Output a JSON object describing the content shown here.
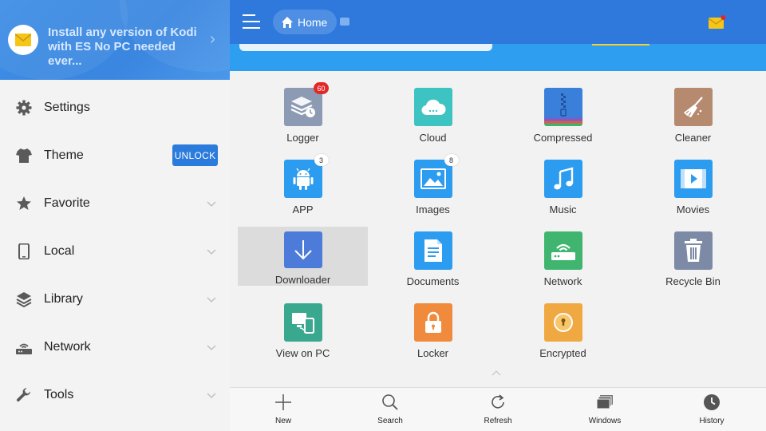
{
  "promo": {
    "text": "Install any version of Kodi with ES No PC needed ever..."
  },
  "sidebar": {
    "items": [
      {
        "label": "Settings",
        "icon": "gear-icon"
      },
      {
        "label": "Theme",
        "icon": "shirt-icon",
        "action": "UNLOCK"
      },
      {
        "label": "Favorite",
        "icon": "star-icon"
      },
      {
        "label": "Local",
        "icon": "phone-icon"
      },
      {
        "label": "Library",
        "icon": "layers-icon"
      },
      {
        "label": "Network",
        "icon": "router-icon"
      },
      {
        "label": "Tools",
        "icon": "wrench-icon"
      }
    ]
  },
  "header": {
    "breadcrumb": "Home"
  },
  "grid": [
    {
      "label": "Logger",
      "badge": "60",
      "color": "#8c9bb3"
    },
    {
      "label": "Cloud",
      "badge": "",
      "color": "#3ec3c3"
    },
    {
      "label": "Compressed",
      "badge": "",
      "color": "#3a7fd9"
    },
    {
      "label": "Cleaner",
      "badge": "",
      "color": "#b58a6e"
    },
    {
      "label": "APP",
      "badge": "3",
      "color": "#2b9cf0"
    },
    {
      "label": "Images",
      "badge": "8",
      "color": "#2b9cf0"
    },
    {
      "label": "Music",
      "badge": "",
      "color": "#2b9cf0"
    },
    {
      "label": "Movies",
      "badge": "",
      "color": "#2b9cf0"
    },
    {
      "label": "Downloader",
      "badge": "",
      "color": "#4d7bd9"
    },
    {
      "label": "Documents",
      "badge": "",
      "color": "#2b9cf0"
    },
    {
      "label": "Network",
      "badge": "",
      "color": "#3fb56f"
    },
    {
      "label": "Recycle Bin",
      "badge": "",
      "color": "#7d8aa6"
    },
    {
      "label": "View on PC",
      "badge": "",
      "color": "#3aa88f"
    },
    {
      "label": "Locker",
      "badge": "",
      "color": "#f08a3c"
    },
    {
      "label": "Encrypted",
      "badge": "",
      "color": "#f0a842"
    }
  ],
  "bottombar": [
    {
      "label": "New"
    },
    {
      "label": "Search"
    },
    {
      "label": "Refresh"
    },
    {
      "label": "Windows"
    },
    {
      "label": "History"
    }
  ]
}
